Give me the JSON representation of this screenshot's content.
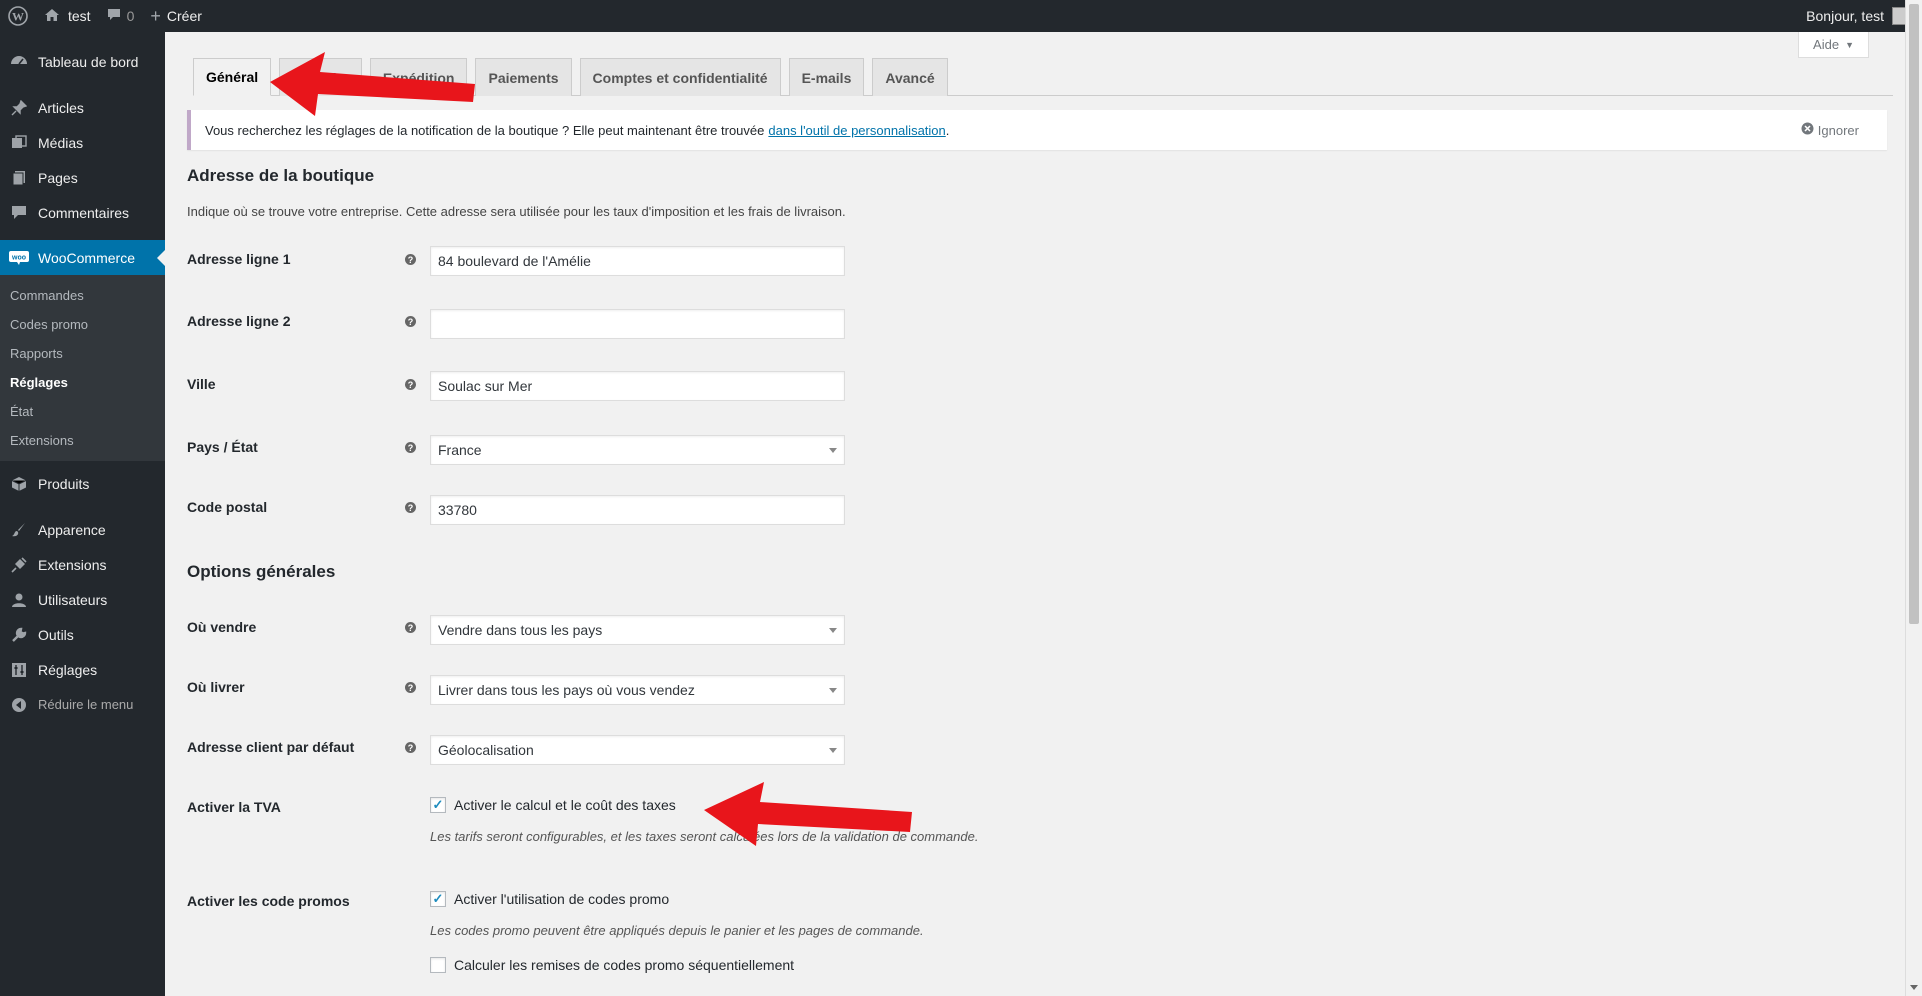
{
  "adminbar": {
    "site_name": "test",
    "comments_count": "0",
    "create_label": "Créer",
    "greeting": "Bonjour, test"
  },
  "sidebar": {
    "items": [
      {
        "label": "Tableau de bord",
        "icon": "dashboard-icon"
      },
      {
        "label": "Articles",
        "icon": "pin-icon"
      },
      {
        "label": "Médias",
        "icon": "media-icon"
      },
      {
        "label": "Pages",
        "icon": "pages-icon"
      },
      {
        "label": "Commentaires",
        "icon": "comment-icon"
      },
      {
        "label": "WooCommerce",
        "icon": "woo-icon"
      }
    ],
    "submenu": [
      "Commandes",
      "Codes promo",
      "Rapports",
      "Réglages",
      "État",
      "Extensions"
    ],
    "items2": [
      {
        "label": "Produits",
        "icon": "products-icon"
      },
      {
        "label": "Apparence",
        "icon": "brush-icon"
      },
      {
        "label": "Extensions",
        "icon": "plugin-icon"
      },
      {
        "label": "Utilisateurs",
        "icon": "users-icon"
      },
      {
        "label": "Outils",
        "icon": "wrench-icon"
      },
      {
        "label": "Réglages",
        "icon": "settings-icon"
      }
    ],
    "collapse": "Réduire le menu"
  },
  "help_label": "Aide",
  "tabs": [
    "Général",
    "Produits",
    "Expédition",
    "Paiements",
    "Comptes et confidentialité",
    "E-mails",
    "Avancé"
  ],
  "notice": {
    "text": "Vous recherchez les réglages de la notification de la boutique ? Elle peut maintenant être trouvée",
    "link": "dans l'outil de personnalisation",
    "end": ".",
    "dismiss": "Ignorer"
  },
  "store_address": {
    "title": "Adresse de la boutique",
    "description": "Indique où se trouve votre entreprise. Cette adresse sera utilisée pour les taux d'imposition et les frais de livraison.",
    "fields": [
      {
        "label": "Adresse ligne 1",
        "value": "84 boulevard de l'Amélie"
      },
      {
        "label": "Adresse ligne 2",
        "value": ""
      },
      {
        "label": "Ville",
        "value": "Soulac sur Mer"
      },
      {
        "label": "Pays / État",
        "value": "France"
      },
      {
        "label": "Code postal",
        "value": "33780"
      }
    ]
  },
  "general_options": {
    "title": "Options générales",
    "fields": [
      {
        "label": "Où vendre",
        "value": "Vendre dans tous les pays"
      },
      {
        "label": "Où livrer",
        "value": "Livrer dans tous les pays où vous vendez"
      },
      {
        "label": "Adresse client par défaut",
        "value": "Géolocalisation"
      }
    ],
    "tax": {
      "label": "Activer la TVA",
      "checkbox": "Activer le calcul et le coût des taxes",
      "checked": true,
      "desc": "Les tarifs seront configurables, et les taxes seront calculées lors de la validation de commande."
    },
    "coupons": {
      "label": "Activer les code promos",
      "checkbox": "Activer l'utilisation de codes promo",
      "checked": true,
      "desc": "Les codes promo peuvent être appliqués depuis le panier et les pages de commande.",
      "checkbox2": "Calculer les remises de codes promo séquentiellement",
      "checked2": false
    }
  },
  "colors": {
    "admin_bar": "#23282d",
    "accent": "#0073aa",
    "arrow": "#e8151b"
  }
}
